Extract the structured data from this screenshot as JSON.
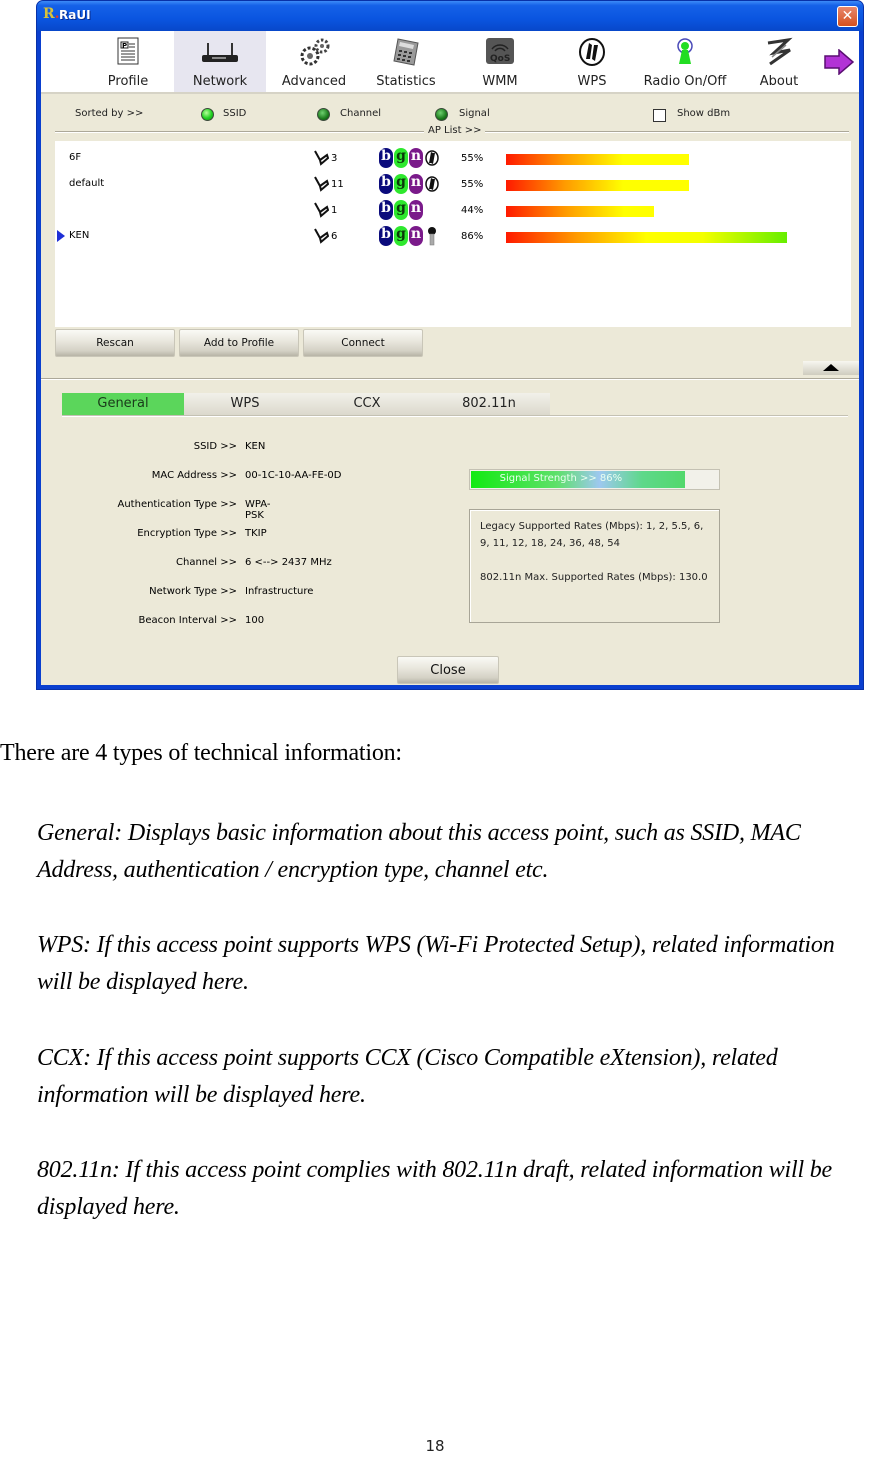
{
  "window": {
    "title": "RaUI",
    "close_label": "✕"
  },
  "toolbar": {
    "items": [
      {
        "label": "Profile",
        "icon": "profile-icon"
      },
      {
        "label": "Network",
        "icon": "network-router-icon",
        "active": true
      },
      {
        "label": "Advanced",
        "icon": "gears-icon"
      },
      {
        "label": "Statistics",
        "icon": "calculator-icon"
      },
      {
        "label": "WMM",
        "icon": "qos-icon"
      },
      {
        "label": "WPS",
        "icon": "wps-icon"
      },
      {
        "label": "Radio On/Off",
        "icon": "radio-antenna-icon"
      },
      {
        "label": "About",
        "icon": "about-logo-icon"
      }
    ],
    "next_icon": "arrow-right-icon"
  },
  "sort": {
    "label": "Sorted by >>",
    "options": [
      {
        "label": "SSID",
        "selected": true
      },
      {
        "label": "Channel",
        "selected": false
      },
      {
        "label": "Signal",
        "selected": false
      }
    ],
    "show_dbm": {
      "label": "Show dBm",
      "checked": false
    }
  },
  "ap_list": {
    "title": "AP List >>",
    "rows": [
      {
        "ssid": "6F",
        "channel": "3",
        "modes": [
          "b",
          "g",
          "n"
        ],
        "extra": "wps",
        "signal": "55%",
        "signal_value": 55,
        "selected": false
      },
      {
        "ssid": "default",
        "channel": "11",
        "modes": [
          "b",
          "g",
          "n"
        ],
        "extra": "wps",
        "signal": "55%",
        "signal_value": 55,
        "selected": false
      },
      {
        "ssid": "",
        "channel": "1",
        "modes": [
          "b",
          "g",
          "n"
        ],
        "extra": "",
        "signal": "44%",
        "signal_value": 44,
        "selected": false
      },
      {
        "ssid": "KEN",
        "channel": "6",
        "modes": [
          "b",
          "g",
          "n"
        ],
        "extra": "key",
        "signal": "86%",
        "signal_value": 86,
        "selected": true
      }
    ]
  },
  "buttons": {
    "rescan": "Rescan",
    "add_to_profile": "Add to Profile",
    "connect": "Connect",
    "close": "Close"
  },
  "tabs": [
    {
      "label": "General",
      "active": true
    },
    {
      "label": "WPS",
      "active": false
    },
    {
      "label": "CCX",
      "active": false
    },
    {
      "label": "802.11n",
      "active": false
    }
  ],
  "general": {
    "fields": [
      {
        "label": "SSID >>",
        "value": "KEN"
      },
      {
        "label": "MAC Address >>",
        "value": "00-1C-10-AA-FE-0D"
      },
      {
        "label": "Authentication Type >>",
        "value": "WPA-PSK"
      },
      {
        "label": "Encryption Type >>",
        "value": "TKIP"
      },
      {
        "label": "Channel >>",
        "value": "6 <--> 2437 MHz"
      },
      {
        "label": "Network Type >>",
        "value": "Infrastructure"
      },
      {
        "label": "Beacon Interval >>",
        "value": "100"
      }
    ],
    "signal_strength": {
      "text": "Signal Strength >> 86%",
      "value": 86
    },
    "rates": {
      "legacy": "Legacy Supported Rates (Mbps): 1, 2, 5.5, 6, 9, 11, 12, 18, 24, 36, 48, 54",
      "n_max": "802.11n Max. Supported Rates (Mbps): 130.0"
    }
  },
  "document": {
    "intro": "There are 4 types of technical information:",
    "paragraphs": [
      "General: Displays basic information about this access point, such as SSID, MAC Address, authentication / encryption type, channel etc.",
      "WPS: If this access point supports WPS (Wi-Fi Protected Setup), related information will be displayed here.",
      "CCX: If this access point supports CCX (Cisco Compatible eXtension), related information will be displayed here.",
      "802.11n: If this access point complies with 802.11n draft, related information will be displayed here."
    ],
    "page_number": "18"
  }
}
